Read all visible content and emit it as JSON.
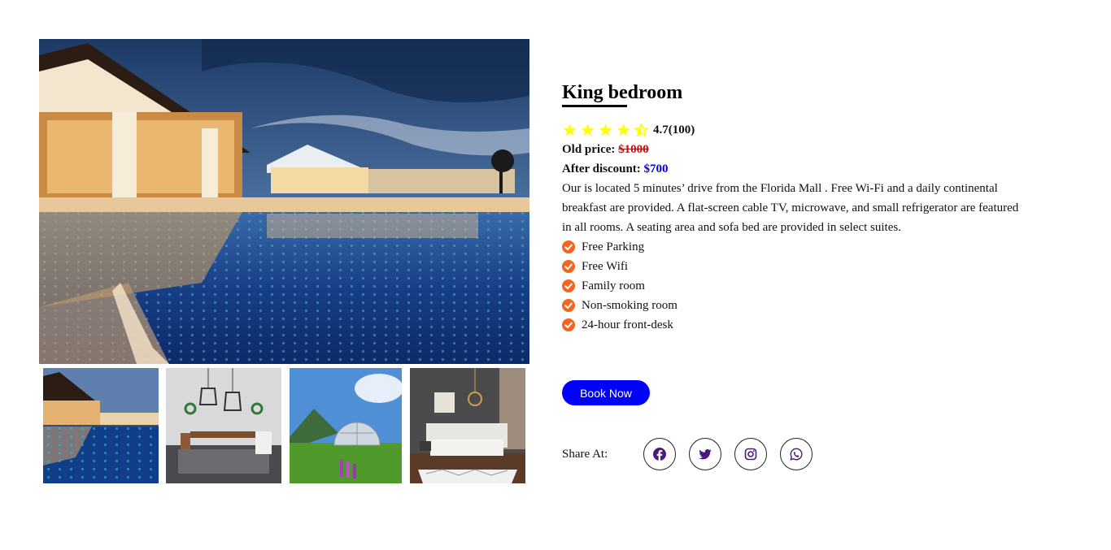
{
  "room": {
    "title": "King bedroom",
    "rating": "4.7(100)",
    "stars": {
      "value": 4.5,
      "max": 5,
      "color": "#ffff00"
    },
    "old_price_label": "Old price:",
    "old_price": "$1000",
    "discount_label": "After discount:",
    "discount_price": "$700",
    "description": "Our is located 5 minutes’ drive from the Florida Mall . Free Wi-Fi and a daily continental breakfast are provided. A flat-screen cable TV, microwave, and small refrigerator are featured in all rooms. A seating area and sofa bed are provided in select suites.",
    "amenities": [
      "Free Parking",
      "Free Wifi",
      "Family room",
      "Non-smoking room",
      "24-hour front-desk"
    ]
  },
  "actions": {
    "book_label": "Book Now"
  },
  "share": {
    "label": "Share At:",
    "icons": [
      "facebook-icon",
      "twitter-icon",
      "instagram-icon",
      "whatsapp-icon"
    ]
  },
  "gallery": {
    "main": "resort-pool-photo",
    "thumbnails": [
      "resort-pool-thumb",
      "dining-room-thumb",
      "glamping-dome-thumb",
      "bedroom-thumb"
    ]
  },
  "colors": {
    "accent": "#0000ff",
    "old_price": "#e00000",
    "check": "#f26522",
    "star": "#ffff00",
    "social_icon": "#4b1a7a"
  }
}
